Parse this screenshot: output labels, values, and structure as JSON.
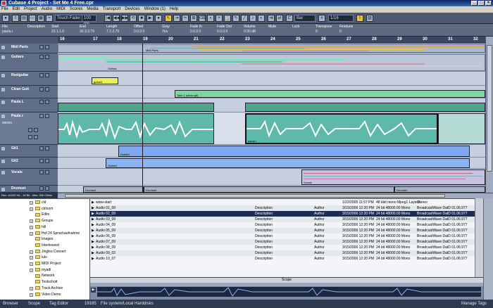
{
  "window": {
    "title": "Cubase 4 Project - Set Me 4 Free.cpr",
    "controls": [
      "_",
      "□",
      "×"
    ]
  },
  "menu": [
    "File",
    "Edit",
    "Project",
    "Audio",
    "MIDI",
    "Scores",
    "Media",
    "Transport",
    "Devices",
    "Window (1)",
    "Help"
  ],
  "toolbar": {
    "automation_mode": "Touch Fader",
    "zoom": "100 ms",
    "snap_type": "Bar",
    "quantize": "1/16"
  },
  "infoline": {
    "labels": [
      "File",
      "Description",
      "Start",
      "End",
      "Length",
      "Offset",
      "Gray",
      "Fade In",
      "Fade Out",
      "Volume",
      "Mute",
      "Lock",
      "Transpose",
      "Finetune"
    ],
    "values": [
      "paula.r",
      "",
      "23.1.1.0",
      "30.3.3.79",
      "7.2.2.79",
      "0.0.0.0",
      "Yes",
      "0.0.0.0",
      "0.0.0.0",
      "0.00 dB",
      "",
      "",
      "0",
      "0"
    ]
  },
  "ruler": {
    "bars": [
      "16",
      "17",
      "18",
      "19",
      "20",
      "21",
      "22",
      "23",
      "24",
      "25",
      "26",
      "27",
      "28",
      "29",
      "30",
      "31",
      "32"
    ]
  },
  "tracks": [
    {
      "name": "Midi Parts"
    },
    {
      "name": "Guitars"
    },
    {
      "name": "Reelguitar"
    },
    {
      "name": "Clean Guit"
    },
    {
      "name": "Paula L"
    },
    {
      "name": "Paula r"
    },
    {
      "name": "Git1"
    },
    {
      "name": "Git2"
    },
    {
      "name": "Vocals"
    },
    {
      "name": "Drumset"
    }
  ],
  "track_sub": {
    "stereo": "stereo"
  },
  "event_labels": {
    "midi_parts": "Midi Parts",
    "guitars": "Guitars",
    "guitar3": "guitar3",
    "take1": "Take 1 (clean git)",
    "paula": "paula r",
    "guitar1": "Guitar1",
    "guitar2": "Guitar2",
    "vocals": "Vocals",
    "drumset1": "Drumset",
    "drumset2": "Drumset",
    "drumset3": "Drumset"
  },
  "project_status": "Rec: 44100 Hz - 16 Bit - Max: 50h 03min",
  "browser_tree": [
    {
      "label": "cld",
      "plus": true
    },
    {
      "label": "ctrloom",
      "plus": true
    },
    {
      "label": "Edits",
      "plus": false
    },
    {
      "label": "Groups",
      "plus": true
    },
    {
      "label": "hill",
      "plus": true
    },
    {
      "label": "Hof 24 Sprachaufnahme",
      "plus": true
    },
    {
      "label": "Images",
      "plus": false
    },
    {
      "label": "Interleaved",
      "plus": false
    },
    {
      "label": "Jingles Convert",
      "plus": true
    },
    {
      "label": "lulu",
      "plus": true
    },
    {
      "label": "MIDI Project",
      "plus": true
    },
    {
      "label": "myadi",
      "plus": true
    },
    {
      "label": "Network",
      "plus": false
    },
    {
      "label": "Testschott",
      "plus": false
    },
    {
      "label": "Track Archive",
      "plus": true
    },
    {
      "label": "Video Demo",
      "plus": true
    }
  ],
  "browser_files": [
    {
      "name": "www-start",
      "desc": "",
      "author": "",
      "date": "1/22/2005 11:57 PM",
      "info": "48 kbit mono Mpeg1 Layer3",
      "wave": "Stereo",
      "sel": false
    },
    {
      "name": "Audio 01_09",
      "desc": "Description",
      "author": "Author",
      "date": "3/15/2006 12:20 PM",
      "info": "24 bit 48000.00 Mono",
      "wave": "BroadcastWave DatD 01.06.977",
      "sel": false
    },
    {
      "name": "Audio 02_09",
      "desc": "Description",
      "author": "Author",
      "date": "3/15/2006 12:20 PM",
      "info": "24 bit 48000.00 Mono",
      "wave": "BroadcastWave DatD 01.06.977",
      "sel": true
    },
    {
      "name": "Audio 03_09",
      "desc": "Description",
      "author": "Author",
      "date": "3/15/2006 12:20 PM",
      "info": "24 bit 48000.00 Mono",
      "wave": "BroadcastWave DatD 01.06.977",
      "sel": false
    },
    {
      "name": "Audio 04_09",
      "desc": "Description",
      "author": "Author",
      "date": "3/15/2006 12:20 PM",
      "info": "24 bit 48000.00 Mono",
      "wave": "BroadcastWave DatD 01.06.977",
      "sel": false
    },
    {
      "name": "Audio 05_09",
      "desc": "Description",
      "author": "Author",
      "date": "3/15/2006 12:20 PM",
      "info": "24 bit 48000.00 Mono",
      "wave": "BroadcastWave DatD 01.06.977",
      "sel": false
    },
    {
      "name": "Audio 06_09",
      "desc": "Description",
      "author": "Author",
      "date": "3/15/2006 12:20 PM",
      "info": "24 bit 48000.00 Mono",
      "wave": "BroadcastWave DatD 01.06.977",
      "sel": false
    },
    {
      "name": "Audio 07_09",
      "desc": "Description",
      "author": "Author",
      "date": "3/15/2006 12:20 PM",
      "info": "24 bit 48000.00 Mono",
      "wave": "BroadcastWave DatD 01.06.977",
      "sel": false
    },
    {
      "name": "Audio 08_09",
      "desc": "Description",
      "author": "Author",
      "date": "3/15/2006 12:20 PM",
      "info": "24 bit 48000.00 Mono",
      "wave": "BroadcastWave DatD 01.06.977",
      "sel": false
    },
    {
      "name": "Audio 09_02",
      "desc": "Description",
      "author": "Author",
      "date": "3/15/2006 12:20 PM",
      "info": "24 bit 48000.00 Mono",
      "wave": "BroadcastWave DatD 01.06.977",
      "sel": false
    },
    {
      "name": "Audio 10_07",
      "desc": "Description",
      "author": "Author",
      "date": "3/15/2006 12:20 PM",
      "info": "24 bit 48000.00 Mono",
      "wave": "BroadcastWave DatD 01.06.977",
      "sel": false
    }
  ],
  "scope": {
    "title": "Scope"
  },
  "bottombar": {
    "browser": "Browser",
    "scope": "Scope",
    "tag_editor": "Tag Editor",
    "count": "19185",
    "path": "File system/Local Harddisks",
    "manage_tags": "Manage Tags"
  }
}
